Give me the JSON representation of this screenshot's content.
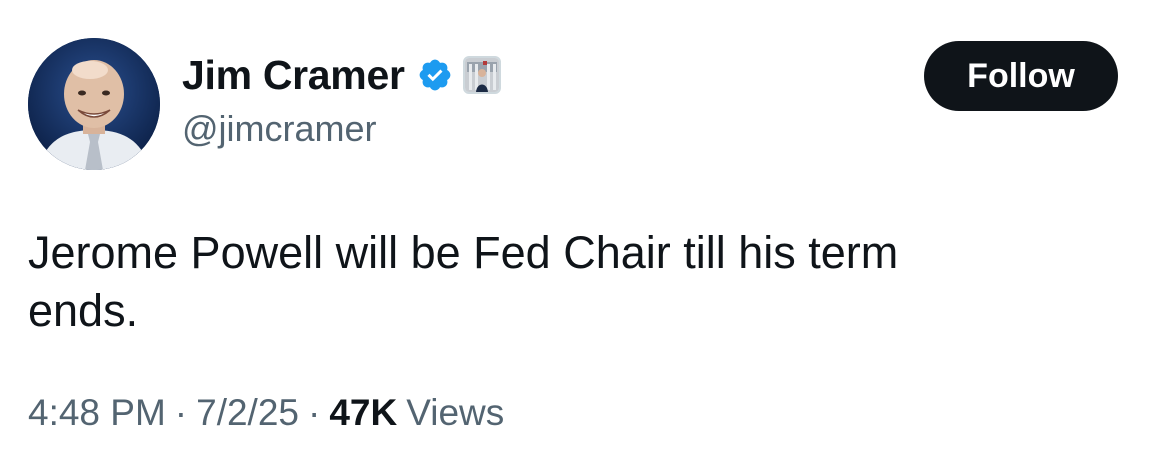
{
  "author": {
    "display_name": "Jim Cramer",
    "handle": "@jimcramer",
    "avatar_icon": "profile-photo",
    "verified_icon": "verified-badge-icon",
    "affiliate_icon": "affiliate-badge-icon"
  },
  "actions": {
    "follow_label": "Follow"
  },
  "tweet": {
    "text": "Jerome Powell will be Fed Chair till his term ends."
  },
  "meta": {
    "time": "4:48 PM",
    "separator": "·",
    "date": "7/2/25",
    "views_count": "47K",
    "views_label": "Views"
  },
  "colors": {
    "text_primary": "#0f1419",
    "text_secondary": "#536471",
    "verified_blue": "#1d9bf0",
    "button_bg": "#0f1419",
    "button_text": "#ffffff",
    "background": "#ffffff"
  }
}
